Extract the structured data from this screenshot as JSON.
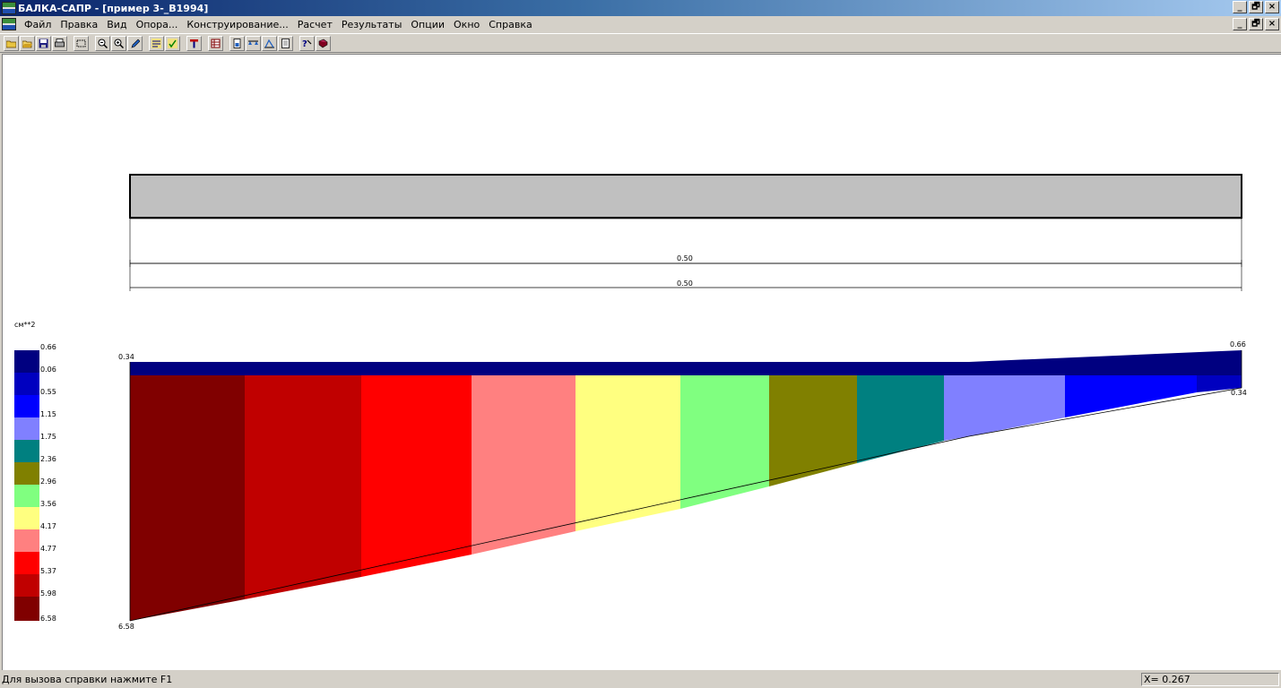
{
  "window": {
    "title": "БАЛКА-САПР - [пример 3-_B1994]",
    "controls": [
      "_",
      "🗗",
      "×"
    ]
  },
  "menu": [
    "Файл",
    "Правка",
    "Вид",
    "Опора...",
    "Конструирование...",
    "Расчет",
    "Результаты",
    "Опции",
    "Окно",
    "Справка"
  ],
  "toolbar": {
    "buttons": [
      "open-icon",
      "open-folder-icon",
      "save-icon",
      "print-icon",
      "select-rect-icon",
      "zoom-out-icon",
      "zoom-in-icon",
      "pencil-icon",
      "beam-loads-icon",
      "check-icon",
      "section-icon",
      "table-icon",
      "page-icon",
      "supports-icon",
      "diagram-icon",
      "report-icon",
      "help-icon",
      "book-icon"
    ]
  },
  "drawing": {
    "dim_upper": "0.50",
    "dim_lower": "0.50",
    "beam_fill": "#c0c0c0"
  },
  "legend": {
    "unit": "см**2",
    "labels": [
      "0.66",
      "0.06",
      "0.55",
      "1.15",
      "1.75",
      "2.36",
      "2.96",
      "3.56",
      "4.17",
      "4.77",
      "5.37",
      "5.98",
      "6.58"
    ],
    "colors": [
      "#000080",
      "#0000c0",
      "#0000ff",
      "#8080ff",
      "#008080",
      "#808000",
      "#80ff80",
      "#ffff80",
      "#ff8080",
      "#ff0000",
      "#c00000",
      "#800000"
    ]
  },
  "diagram": {
    "label_left_top": "0.34",
    "label_left_bottom": "6.58",
    "label_right_top": "0.66",
    "label_right_bottom": "0.34"
  },
  "status": {
    "help": "Для вызова справки нажмите F1",
    "coord": "X= 0.267"
  }
}
